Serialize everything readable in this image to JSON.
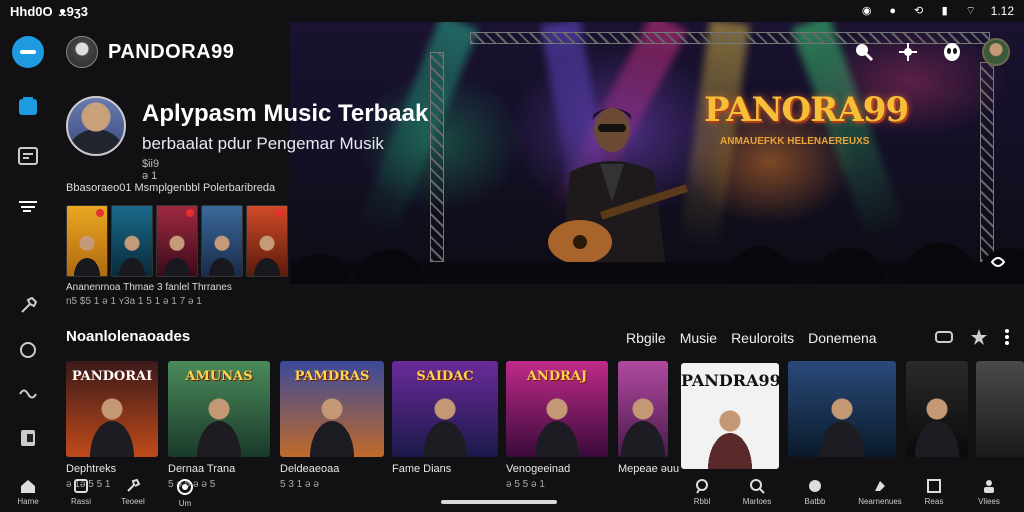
{
  "status_bar": {
    "time": "Hhd0O",
    "carrier": "ᴥ9ʒ3",
    "battery": "1.12"
  },
  "header": {
    "app_title": "PANDORA99"
  },
  "profile": {
    "title": "Aplypasm Music Terbaak",
    "subtitle": "berbaalat pdur Pengemar Musik",
    "count": "$ii9 ǝ 1"
  },
  "promo": {
    "label": "Bbasoraeo01 Msmplgenbbl Polerbaribreda",
    "caption": "Ananenrnoa Thmae 3 fanlel Thrranes",
    "meta": "n5 $5 1 ǝ 1 ʏ3a 1 5 1 ǝ 1 7 ǝ 1"
  },
  "hero": {
    "stage_logo": "PANORA99",
    "stage_sub": "ANMAUEFKK HELENAEREUXS"
  },
  "section": {
    "title": "Noanlolenaoades",
    "tabs": [
      "Rbgile",
      "Musie",
      "Reuloroits",
      "Donemena"
    ]
  },
  "albums": [
    {
      "cover_title": "PANDORAI",
      "caption": "Dephtreks",
      "meta": "ǝ 1ǝ 5 5 1"
    },
    {
      "cover_title": "AMUNAS",
      "caption": "Dernaa Trana",
      "meta": "5 ǝ 5 ǝ ǝ 5"
    },
    {
      "cover_title": "PAMDRAS",
      "caption": "Deldeaeoaa",
      "meta": "5 3 1 ǝ ǝ"
    },
    {
      "cover_title": "SAIDAC",
      "caption": "Fame Dians",
      "meta": ""
    },
    {
      "cover_title": "ANDRAJ",
      "caption": "Venogeeinad",
      "meta": "ǝ 5 5 ǝ 1"
    },
    {
      "cover_title": "",
      "caption": "Mepeae ǝuu",
      "meta": ""
    },
    {
      "cover_title": "PANDRA99",
      "caption": "",
      "meta": ""
    },
    {
      "cover_title": "",
      "caption": "",
      "meta": ""
    },
    {
      "cover_title": "",
      "caption": "",
      "meta": ""
    },
    {
      "cover_title": "",
      "caption": "",
      "meta": ""
    }
  ],
  "bottom_nav": {
    "left": [
      "Hame",
      "Rassi",
      "Teoeel",
      "Um"
    ],
    "right": [
      "Rbbl",
      "Marloes",
      "Batbb",
      "Nearnenues",
      "Reas",
      "Vliees"
    ]
  },
  "colors": {
    "accent": "#1e9be0",
    "gold": "#f5c038",
    "badge_red": "#e53030"
  }
}
